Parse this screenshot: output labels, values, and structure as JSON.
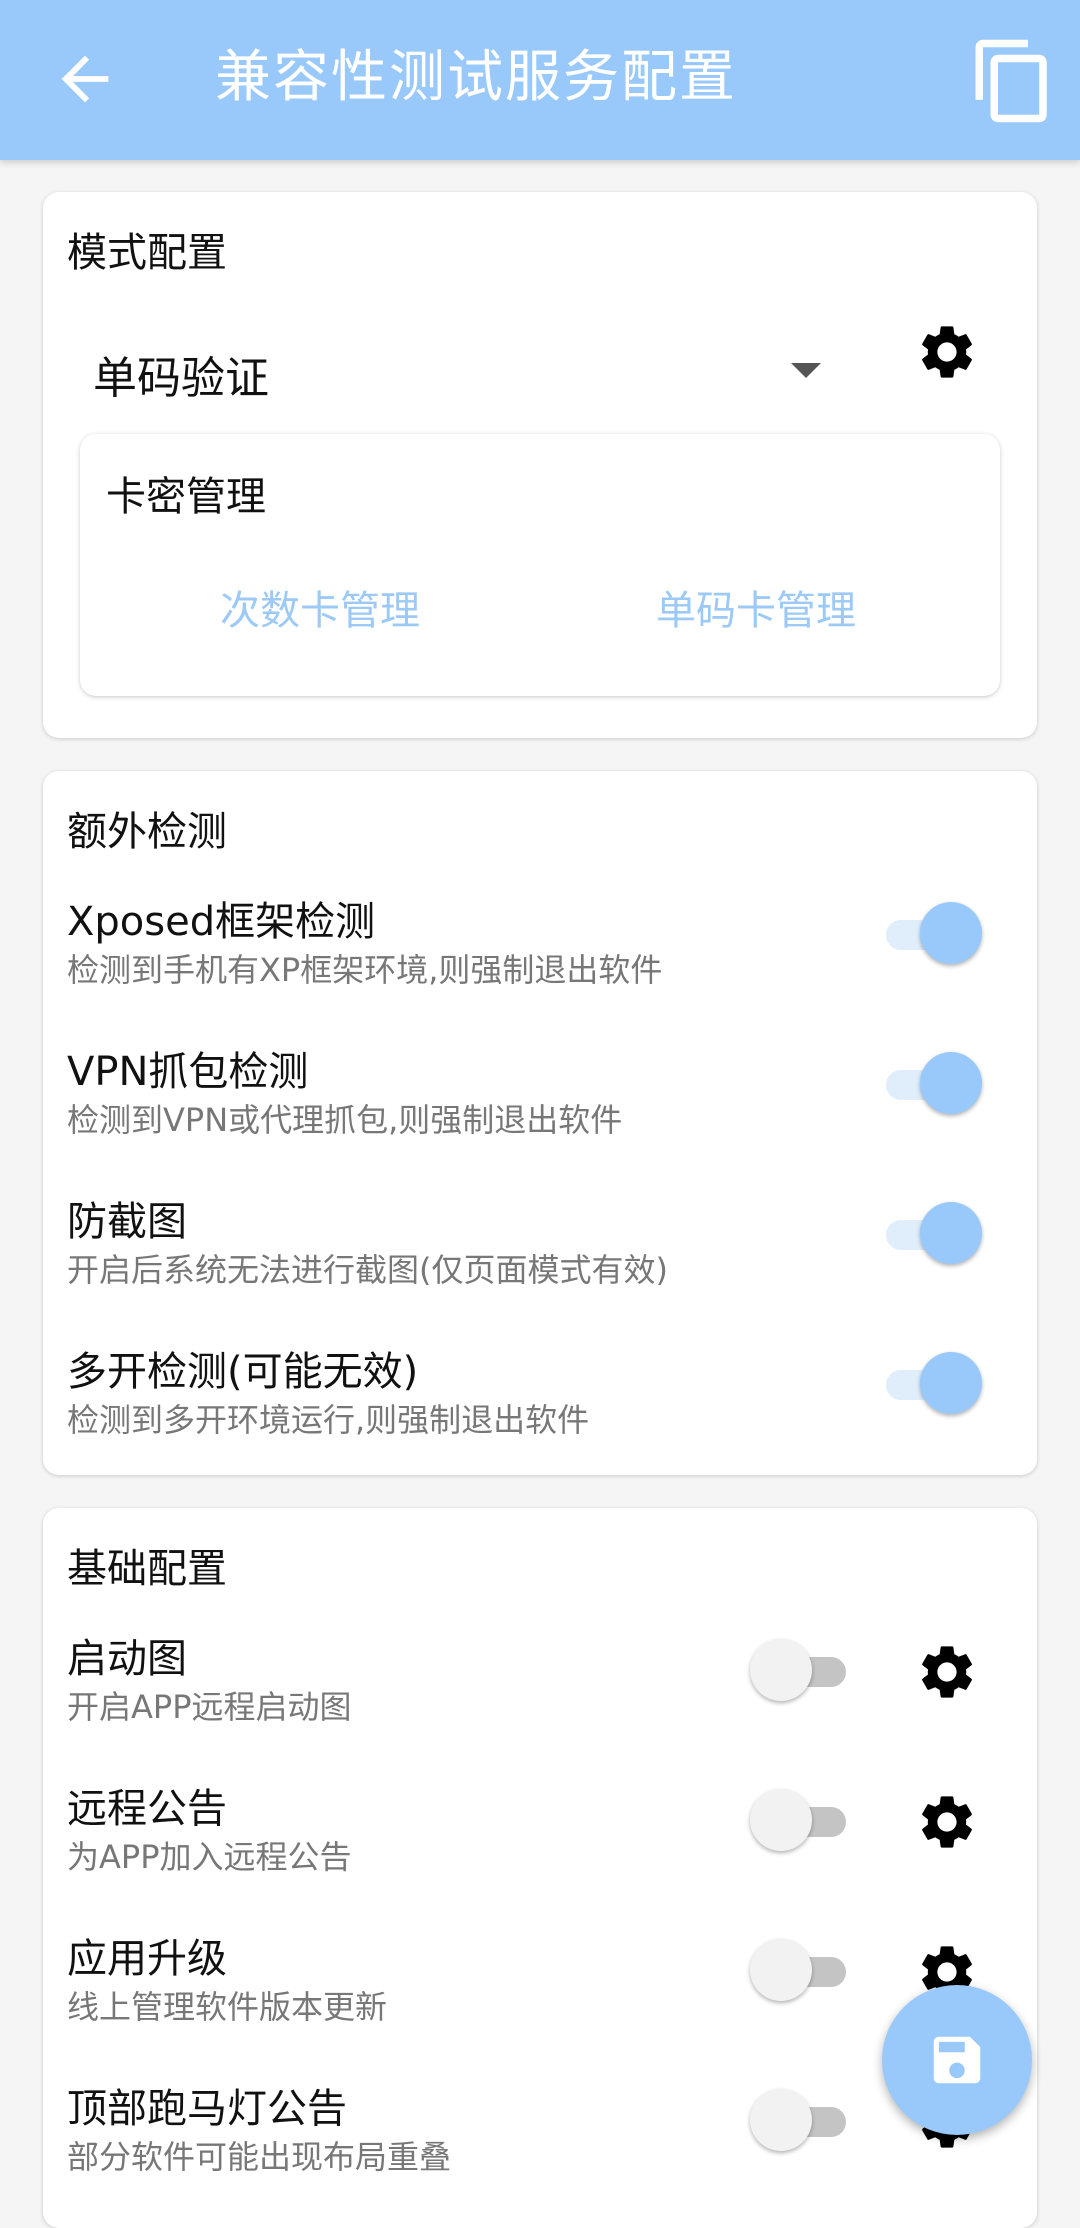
{
  "appbar": {
    "title": "兼容性测试服务配置",
    "back_icon": "arrow-back-icon",
    "copy_icon": "copy-icon",
    "color": "#99c9fb"
  },
  "mode_config": {
    "title": "模式配置",
    "dropdown_value": "单码验证",
    "card_management": {
      "title": "卡密管理",
      "buttons": [
        "次数卡管理",
        "单码卡管理"
      ]
    }
  },
  "extra_detection": {
    "title": "额外检测",
    "items": [
      {
        "title": "Xposed框架检测",
        "subtitle": "检测到手机有XP框架环境,则强制退出软件",
        "enabled": true
      },
      {
        "title": "VPN抓包检测",
        "subtitle": "检测到VPN或代理抓包,则强制退出软件",
        "enabled": true
      },
      {
        "title": "防截图",
        "subtitle": "开启后系统无法进行截图(仅页面模式有效)",
        "enabled": true
      },
      {
        "title": "多开检测(可能无效)",
        "subtitle": "检测到多开环境运行,则强制退出软件",
        "enabled": true
      }
    ]
  },
  "basic_config": {
    "title": "基础配置",
    "items": [
      {
        "title": "启动图",
        "subtitle": "开启APP远程启动图",
        "enabled": false
      },
      {
        "title": "远程公告",
        "subtitle": "为APP加入远程公告",
        "enabled": false
      },
      {
        "title": "应用升级",
        "subtitle": "线上管理软件版本更新",
        "enabled": false
      },
      {
        "title": "顶部跑马灯公告",
        "subtitle": "部分软件可能出现布局重叠",
        "enabled": false
      }
    ]
  },
  "fab": {
    "icon": "save-icon"
  }
}
